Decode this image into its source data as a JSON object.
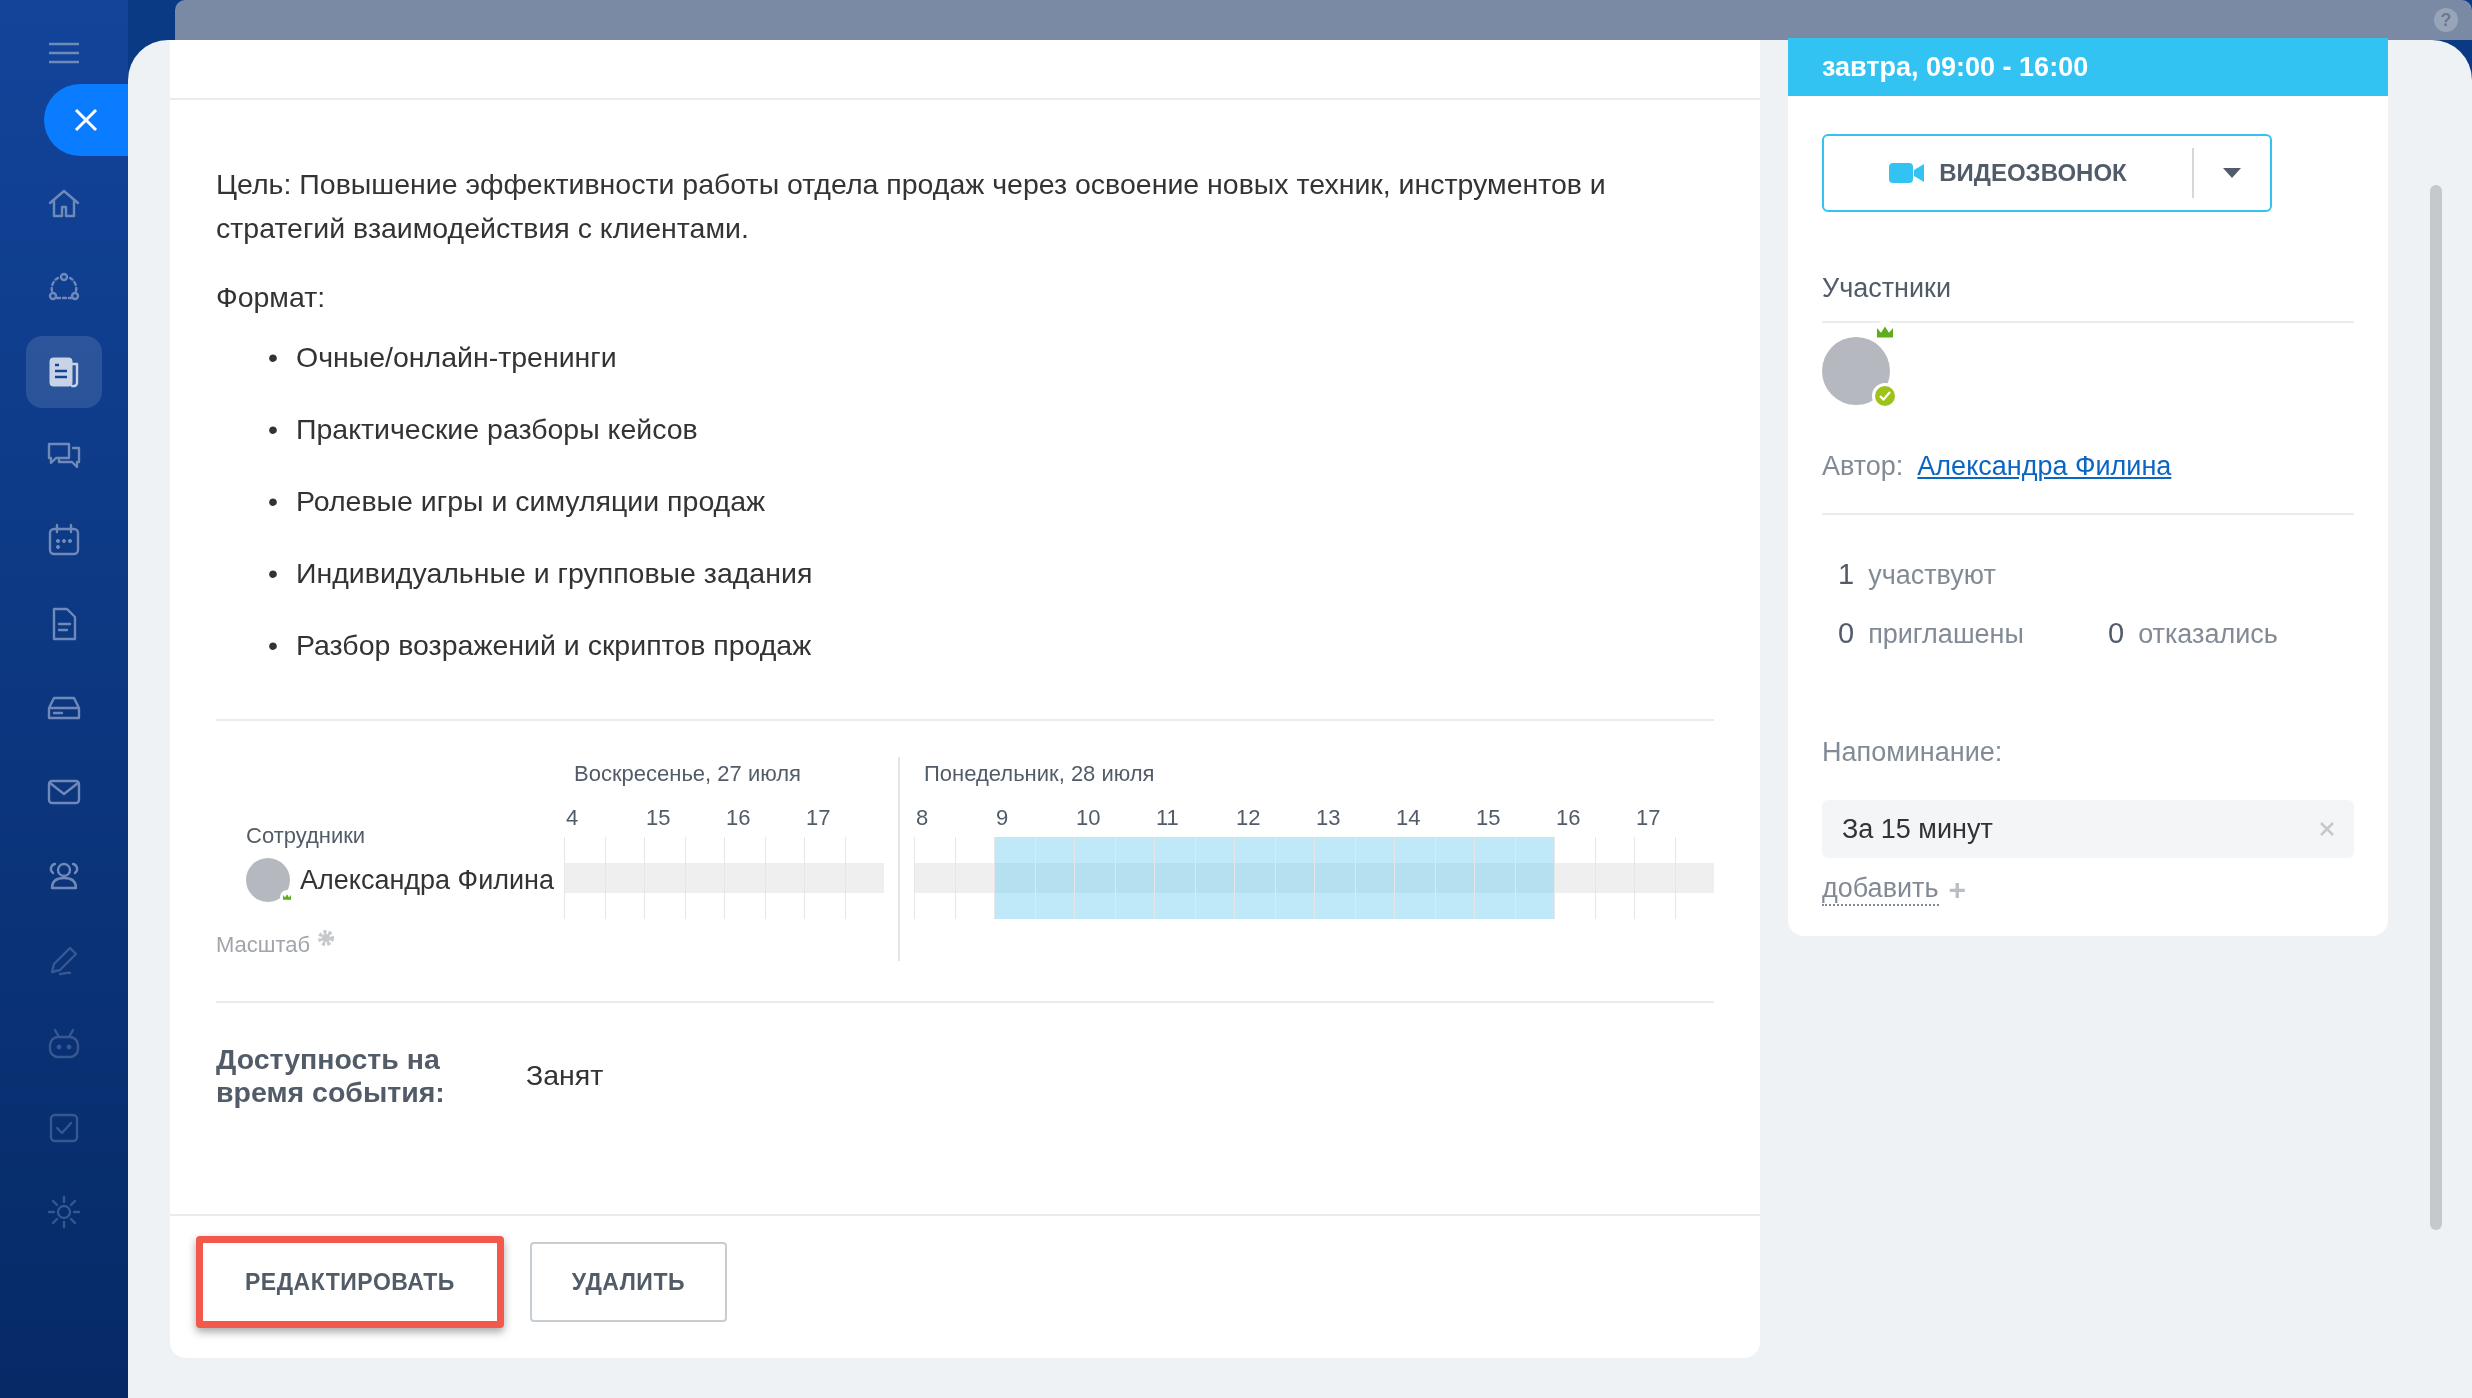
{
  "help": "?",
  "sidebar": {
    "items": [
      {
        "selected": false,
        "dim": false
      },
      {
        "selected": false,
        "dim": false
      },
      {
        "selected": true,
        "dim": false
      },
      {
        "selected": false,
        "dim": false
      },
      {
        "selected": false,
        "dim": false
      },
      {
        "selected": false,
        "dim": false
      },
      {
        "selected": false,
        "dim": false
      },
      {
        "selected": false,
        "dim": false
      },
      {
        "selected": false,
        "dim": false
      },
      {
        "selected": false,
        "dim": true
      },
      {
        "selected": false,
        "dim": true
      },
      {
        "selected": false,
        "dim": true
      },
      {
        "selected": false,
        "dim": true
      }
    ]
  },
  "description": {
    "paragraph": "Цель: Повышение эффективности работы отдела продаж через освоение новых техник, инструментов и стратегий взаимодействия с клиентами.",
    "format_label": "Формат:",
    "items": [
      {
        "bullet": "•",
        "text": "Очные/онлайн-тренинги"
      },
      {
        "bullet": "•",
        "text": "Практические разборы кейсов"
      },
      {
        "bullet": "•",
        "text": "Ролевые игры и симуляции продаж"
      },
      {
        "bullet": "•",
        "text": "Индивидуальные и групповые задания"
      },
      {
        "bullet": "•",
        "text": "Разбор возражений и скриптов продаж"
      }
    ]
  },
  "planner": {
    "employees_label": "Сотрудники",
    "employee": "Александра Филина",
    "scale_label": "Масштаб",
    "days": [
      {
        "date": "Воскресенье, 27 июля",
        "hours": [
          {
            "label": "4",
            "busy": false
          },
          {
            "label": "15",
            "busy": false
          },
          {
            "label": "16",
            "busy": false
          },
          {
            "label": "17",
            "busy": false
          }
        ]
      },
      {
        "date": "Понедельник, 28 июля",
        "hours": [
          {
            "label": "8",
            "busy": false
          },
          {
            "label": "9",
            "busy": true
          },
          {
            "label": "10",
            "busy": true
          },
          {
            "label": "11",
            "busy": true
          },
          {
            "label": "12",
            "busy": true
          },
          {
            "label": "13",
            "busy": true
          },
          {
            "label": "14",
            "busy": true
          },
          {
            "label": "15",
            "busy": true
          },
          {
            "label": "16",
            "busy": false
          },
          {
            "label": "17",
            "busy": false
          }
        ]
      }
    ]
  },
  "availability": {
    "label": "Доступность на время события:",
    "value": "Занят"
  },
  "buttons": [
    {
      "label": "РЕДАКТИРОВАТЬ",
      "highlighted": true
    },
    {
      "label": "УДАЛИТЬ",
      "highlighted": false
    }
  ],
  "side": {
    "time": "завтра, 09:00 - 16:00",
    "video_button": "ВИДЕОЗВОНОК",
    "participants_label": "Участники",
    "author_label": "Автор:",
    "author": "Александра Филина",
    "counts": [
      {
        "count": "1",
        "label": "участвуют"
      },
      {
        "count": "0",
        "label": "приглашены"
      },
      {
        "count": "0",
        "label": "отказались"
      }
    ],
    "reminder_label": "Напоминание:",
    "reminder": "За 15 минут",
    "add": "добавить",
    "add_icon": "+"
  }
}
